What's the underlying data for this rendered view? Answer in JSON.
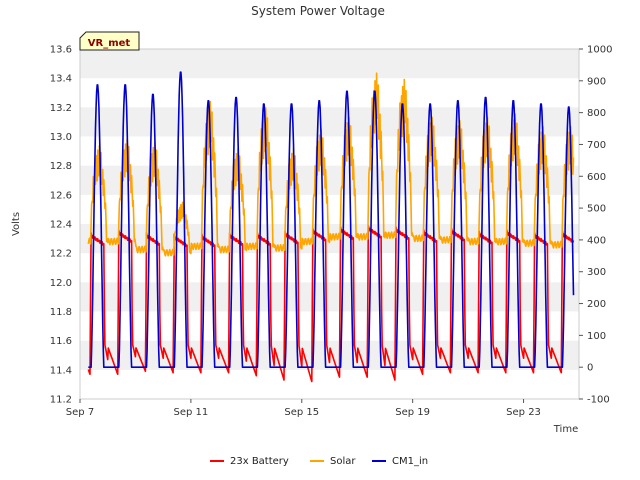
{
  "chart_data": {
    "type": "line",
    "title": "System Power Voltage",
    "site_label": "VR_met",
    "xlabel": "Time",
    "ylabel": "Volts",
    "x_ticks": [
      {
        "day": 7,
        "label": "Sep 7"
      },
      {
        "day": 11,
        "label": "Sep 11"
      },
      {
        "day": 15,
        "label": "Sep 15"
      },
      {
        "day": 19,
        "label": "Sep 19"
      },
      {
        "day": 23,
        "label": "Sep 23"
      }
    ],
    "xlim": [
      7.0,
      25.0
    ],
    "ylim_left": [
      11.2,
      13.6
    ],
    "yticks_left": [
      "11.2",
      "11.4",
      "11.6",
      "11.8",
      "12.0",
      "12.2",
      "12.4",
      "12.6",
      "12.8",
      "13.0",
      "13.2",
      "13.4",
      "13.6"
    ],
    "ylim_right": [
      -100,
      1000
    ],
    "yticks_right": [
      "-100",
      "0",
      "100",
      "200",
      "300",
      "400",
      "500",
      "600",
      "700",
      "800",
      "900",
      "1000"
    ],
    "grid": "horizontal bands",
    "legend_placement": "bottom",
    "series": [
      {
        "name": "23x Battery",
        "axis": "left",
        "color": "#ff0000",
        "peak_day_offset": 0.42,
        "start_day": 7.3,
        "end_day": 24.8,
        "daily_peaks": [
          12.3,
          12.32,
          12.3,
          12.29,
          12.29,
          12.3,
          12.3,
          12.31,
          12.33,
          12.34,
          12.35,
          12.34,
          12.32,
          12.33,
          12.31,
          12.32,
          12.3,
          12.31
        ],
        "daily_minimums": [
          11.37,
          11.39,
          11.38,
          11.38,
          11.38,
          11.36,
          11.33,
          11.32,
          11.35,
          11.35,
          11.33,
          11.37,
          11.38,
          11.38,
          11.38,
          11.38,
          11.38,
          11.38
        ]
      },
      {
        "name": "Solar",
        "axis": "right",
        "color": "#ffa500",
        "start_day": 7.3,
        "end_day": 24.8,
        "baseline": 400,
        "daily_peaks": [
          700,
          720,
          710,
          520,
          840,
          690,
          820,
          690,
          750,
          790,
          930,
          910,
          790,
          780,
          790,
          800,
          760,
          760
        ],
        "daily_lows": [
          395,
          395,
          370,
          360,
          380,
          370,
          380,
          375,
          395,
          410,
          410,
          415,
          405,
          400,
          395,
          395,
          390,
          385
        ]
      },
      {
        "name": "CM1_in",
        "axis": "right",
        "color": "#0000cc",
        "start_day": 7.3,
        "end_day": 24.8,
        "baseline": 0,
        "daily_peaks": [
          890,
          890,
          860,
          930,
          840,
          850,
          830,
          830,
          840,
          870,
          870,
          830,
          830,
          840,
          850,
          840,
          830,
          820
        ]
      }
    ]
  }
}
